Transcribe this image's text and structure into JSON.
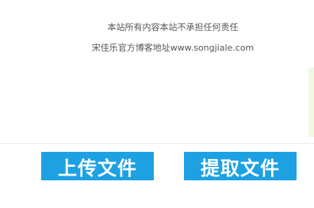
{
  "notice": {
    "disclaimer": "本站所有内容本站不承担任何责任",
    "blog": "宋佳乐官方博客地址www.songjiale.com"
  },
  "actions": {
    "upload_label": "上传文件",
    "extract_label": "提取文件"
  },
  "colors": {
    "button_bg": "#1da1e2",
    "button_text": "#ffffff",
    "side_strip": "#eef8e6"
  }
}
